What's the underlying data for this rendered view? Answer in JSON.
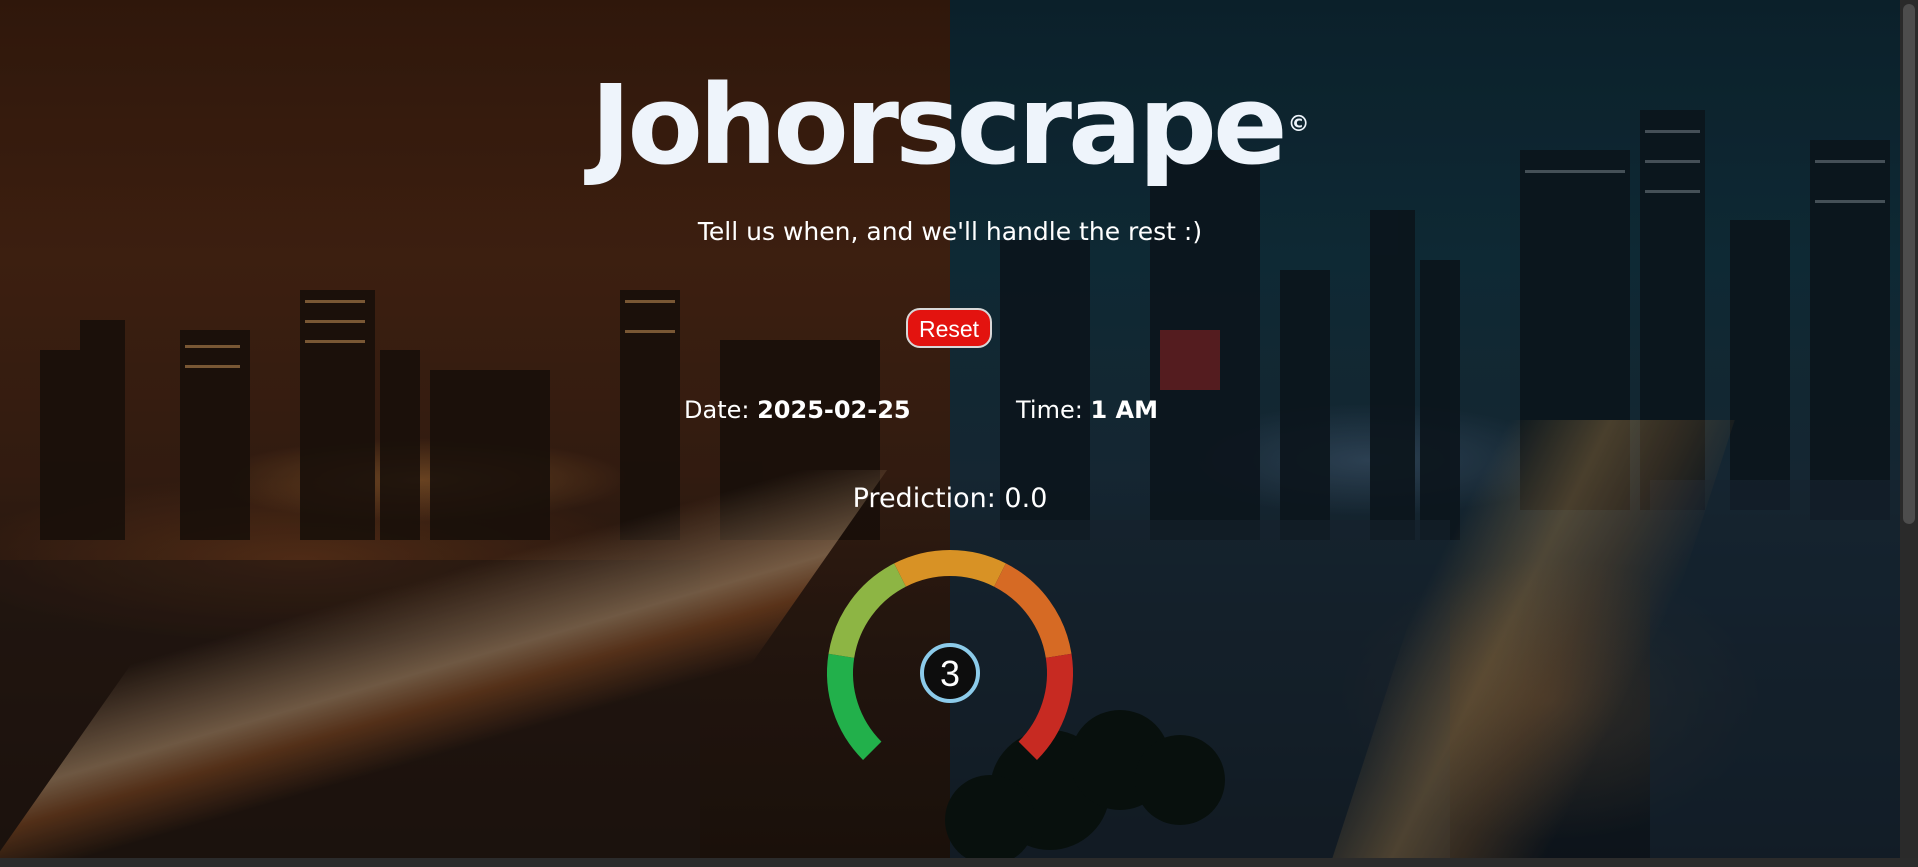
{
  "app": {
    "title": "Johorscrape",
    "copyright_mark": "©",
    "tagline": "Tell us when, and we'll handle the rest :)"
  },
  "controls": {
    "reset_label": "Reset"
  },
  "selection": {
    "date_label": "Date:",
    "date_value": "2025-02-25",
    "time_label": "Time:",
    "time_value": "1 AM"
  },
  "prediction": {
    "text": "Prediction: 0.0"
  },
  "gauge": {
    "value": "3",
    "segment_colors": [
      "#22b04b",
      "#8db544",
      "#d89225",
      "#d66a24",
      "#c72a22"
    ],
    "center_ring_color": "#8ccbea"
  },
  "colors": {
    "reset_bg": "#e3130f",
    "title_color": "#eef4fb"
  }
}
